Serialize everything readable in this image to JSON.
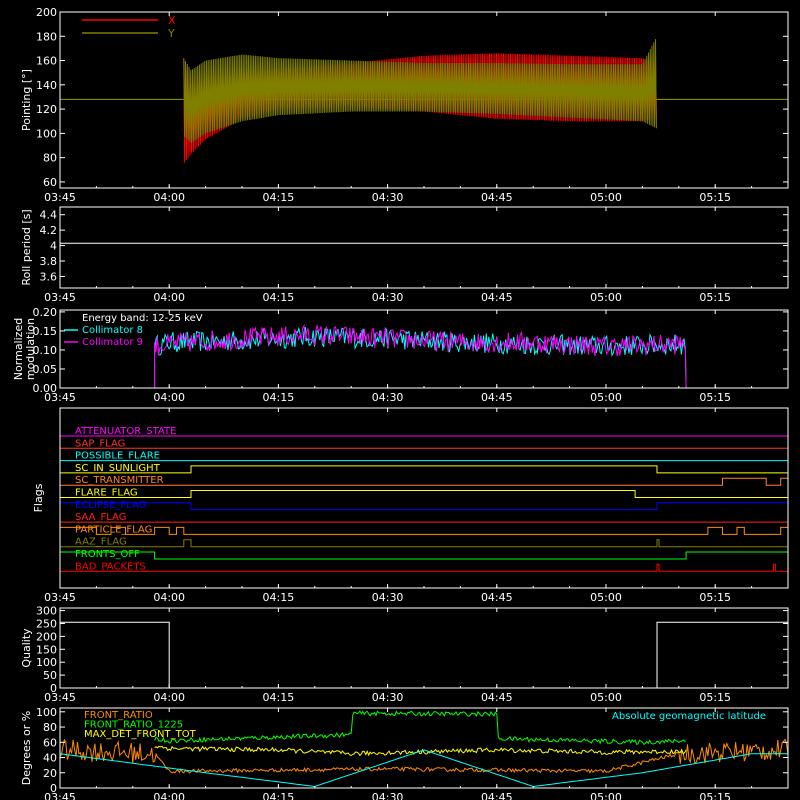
{
  "chart_data": [
    {
      "type": "line",
      "panel": "pointing",
      "ylabel": "Pointing [°]",
      "ylim": [
        55,
        200
      ],
      "yticks": [
        60,
        80,
        100,
        120,
        140,
        160,
        180,
        200
      ],
      "xlim": [
        "03:45",
        "05:25"
      ],
      "xticks": [
        "03:45",
        "04:00",
        "04:15",
        "04:30",
        "04:45",
        "05:00",
        "05:15"
      ],
      "series": [
        {
          "name": "X",
          "color": "#ff0000",
          "envelope": {
            "x": [
              "04:02",
              "04:03",
              "04:05",
              "04:10",
              "04:15",
              "04:25",
              "04:35",
              "04:45",
              "04:55",
              "05:05",
              "05:07"
            ],
            "upper": [
              162,
              140,
              145,
              150,
              153,
              158,
              164,
              166,
              164,
              162,
              160
            ],
            "lower": [
              75,
              83,
              95,
              112,
              120,
              122,
              118,
              112,
              110,
              110,
              112
            ]
          }
        },
        {
          "name": "Y",
          "color": "#808000",
          "envelope": {
            "x": [
              "04:02",
              "04:03",
              "04:05",
              "04:10",
              "04:15",
              "04:25",
              "04:35",
              "04:45",
              "04:55",
              "05:05",
              "05:07"
            ],
            "upper": [
              162,
              152,
              160,
              165,
              162,
              160,
              158,
              158,
              157,
              157,
              180
            ],
            "lower": [
              98,
              92,
              100,
              110,
              115,
              118,
              118,
              116,
              113,
              110,
              104
            ]
          }
        }
      ],
      "reference_line": 128
    },
    {
      "type": "line",
      "panel": "roll",
      "ylabel": "Roll period [s]",
      "ylim": [
        3.45,
        4.5
      ],
      "yticks": [
        3.6,
        3.8,
        4.0,
        4.2,
        4.4
      ],
      "xticks": [
        "03:45",
        "04:00",
        "04:15",
        "04:30",
        "04:45",
        "05:00",
        "05:15"
      ],
      "series": [
        {
          "name": "",
          "color": "#ffffff",
          "x": [
            "03:45",
            "05:25"
          ],
          "y": [
            4.03,
            4.03
          ]
        }
      ]
    },
    {
      "type": "line",
      "panel": "modulation",
      "ylabel": "Normalized modulation",
      "ylim": [
        0,
        0.205
      ],
      "yticks": [
        "0.00",
        "0.05",
        "0.10",
        "0.15",
        "0.20"
      ],
      "xticks": [
        "03:45",
        "04:00",
        "04:15",
        "04:30",
        "04:45",
        "05:00",
        "05:15"
      ],
      "annotation": "Energy band: 12-25 keV",
      "series": [
        {
          "name": "Collimator 8",
          "color": "#00ffff",
          "x": [
            "03:58",
            "04:00",
            "04:10",
            "04:20",
            "04:30",
            "04:40",
            "04:50",
            "05:00",
            "05:10"
          ],
          "y": [
            0.11,
            0.12,
            0.125,
            0.135,
            0.13,
            0.12,
            0.115,
            0.11,
            0.115
          ]
        },
        {
          "name": "Collimator 9",
          "color": "#ff00ff",
          "x": [
            "03:58",
            "04:00",
            "04:10",
            "04:20",
            "04:30",
            "04:40",
            "04:50",
            "05:00",
            "05:10"
          ],
          "y": [
            0.11,
            0.115,
            0.13,
            0.14,
            0.13,
            0.12,
            0.12,
            0.11,
            0.115
          ]
        }
      ],
      "active_range": [
        "03:58",
        "05:11"
      ]
    },
    {
      "type": "line",
      "panel": "flags",
      "ylabel": "Flags",
      "xticks": [
        "03:45",
        "04:00",
        "04:15",
        "04:30",
        "04:45",
        "05:00",
        "05:15"
      ],
      "flags": [
        {
          "name": "ATTENUATOR_STATE",
          "color": "#ff00ff",
          "highs": []
        },
        {
          "name": "SAP_FLAG",
          "color": "#ff3030",
          "highs": []
        },
        {
          "name": "POSSIBLE_FLARE",
          "color": "#00ffff",
          "highs": []
        },
        {
          "name": "SC_IN_SUNLIGHT",
          "color": "#ffff00",
          "highs": [
            [
              "04:03",
              "05:07"
            ]
          ]
        },
        {
          "name": "SC_TRANSMITTER",
          "color": "#ff8030",
          "highs": [
            [
              "05:16",
              "05:22"
            ],
            [
              "05:24",
              "05:25"
            ]
          ]
        },
        {
          "name": "FLARE_FLAG",
          "color": "#ffff00",
          "highs": [
            [
              "04:03",
              "05:04"
            ]
          ]
        },
        {
          "name": "ECLIPSE_FLAG",
          "color": "#0000ff",
          "highs": [
            [
              "03:45",
              "04:03"
            ],
            [
              "05:07",
              "05:25"
            ]
          ]
        },
        {
          "name": "SAA_FLAG",
          "color": "#ff2020",
          "highs": []
        },
        {
          "name": "PARTICLE_FLAG",
          "color": "#ff8c00",
          "highs": [
            [
              "03:45",
              "03:50"
            ],
            [
              "03:52",
              "03:54"
            ],
            [
              "03:58",
              "04:00"
            ],
            [
              "04:01",
              "04:02"
            ],
            [
              "05:14",
              "05:16"
            ],
            [
              "05:18",
              "05:19"
            ],
            [
              "05:24",
              "05:25"
            ]
          ]
        },
        {
          "name": "AAZ_FLAG",
          "color": "#808000",
          "highs": [
            [
              "04:02",
              "04:03"
            ],
            [
              "05:07",
              "05:07"
            ]
          ]
        },
        {
          "name": "FRONTS_OFF",
          "color": "#00ff00",
          "highs": [
            [
              "03:45",
              "03:58"
            ],
            [
              "05:11",
              "05:25"
            ]
          ]
        },
        {
          "name": "BAD_PACKETS",
          "color": "#ff0000",
          "highs": [
            [
              "05:07",
              "05:07"
            ],
            [
              "05:23",
              "05:23"
            ]
          ]
        }
      ]
    },
    {
      "type": "line",
      "panel": "quality",
      "ylabel": "Quality",
      "ylim": [
        0,
        310
      ],
      "yticks": [
        0,
        50,
        100,
        150,
        200,
        250,
        300
      ],
      "xticks": [
        "03:45",
        "04:00",
        "04:15",
        "04:30",
        "04:45",
        "05:00",
        "05:15"
      ],
      "series": [
        {
          "name": "",
          "color": "#ffffff",
          "x": [
            "03:45",
            "04:00",
            "04:00",
            "05:07",
            "05:07",
            "05:25"
          ],
          "y": [
            255,
            255,
            0,
            0,
            255,
            255
          ]
        }
      ]
    },
    {
      "type": "line",
      "panel": "rates",
      "ylabel": "Degrees or %",
      "ylim": [
        0,
        105
      ],
      "yticks": [
        0,
        20,
        40,
        60,
        80,
        100
      ],
      "xticks": [
        "03:45",
        "04:00",
        "04:15",
        "04:30",
        "04:45",
        "05:00",
        "05:15"
      ],
      "annotation": "Absolute geomagnetic latitude",
      "series": [
        {
          "name": "FRONT_RATIO",
          "color": "#ff8c00",
          "x": [
            "03:45",
            "03:58",
            "04:00",
            "04:30",
            "05:00",
            "05:10",
            "05:25"
          ],
          "y": [
            50,
            45,
            22,
            25,
            22,
            45,
            50
          ]
        },
        {
          "name": "FRONT_RATIO_1225",
          "color": "#00ff00",
          "x": [
            "03:58",
            "04:00",
            "04:25",
            "04:25",
            "04:45",
            "04:45",
            "05:05",
            "05:11"
          ],
          "y": [
            65,
            62,
            70,
            98,
            97,
            65,
            60,
            62
          ]
        },
        {
          "name": "MAX_DET_FRONT_TOT",
          "color": "#ffff00",
          "x": [
            "03:58",
            "04:00",
            "04:15",
            "04:25",
            "04:45",
            "05:00",
            "05:11"
          ],
          "y": [
            55,
            52,
            50,
            45,
            50,
            47,
            48
          ]
        },
        {
          "name": "Absolute geomagnetic latitude",
          "color": "#00ffff",
          "x": [
            "03:45",
            "04:05",
            "04:20",
            "04:35",
            "04:50",
            "05:05",
            "05:20",
            "05:25"
          ],
          "y": [
            45,
            20,
            2,
            50,
            2,
            20,
            45,
            45
          ]
        }
      ]
    }
  ]
}
